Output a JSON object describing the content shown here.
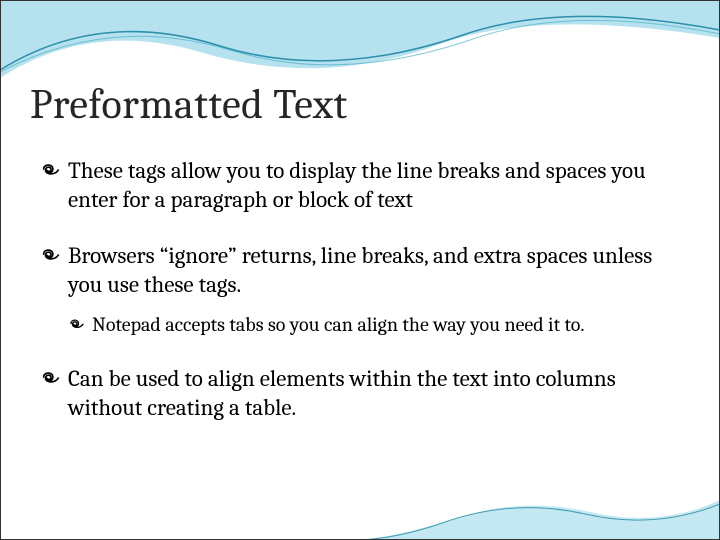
{
  "title": "Preformatted Text",
  "bullets": [
    {
      "level": 1,
      "text": "These tags allow you to display the line breaks and spaces you enter for a paragraph or block of text"
    },
    {
      "level": 1,
      "text": "Browsers “ignore” returns, line breaks, and extra spaces unless you use these tags."
    },
    {
      "level": 2,
      "text": "Notepad accepts tabs so you can align the way you need it to."
    },
    {
      "level": 1,
      "text": "Can be used to align elements within the text into columns without creating a table."
    }
  ]
}
